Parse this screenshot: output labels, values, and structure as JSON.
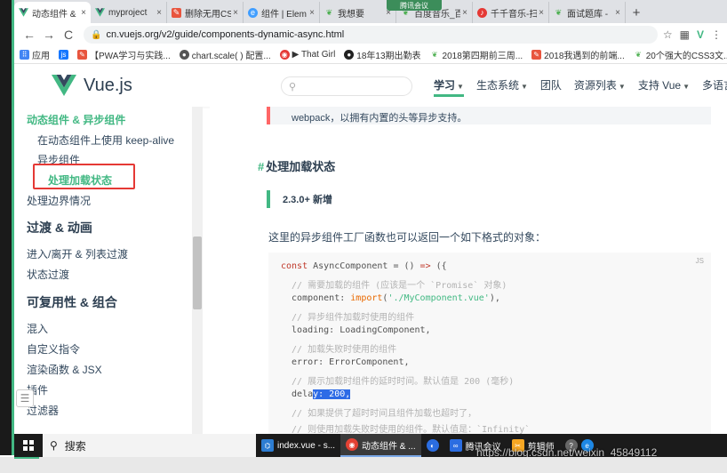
{
  "browser": {
    "tabs": [
      {
        "label": "动态组件 &",
        "icon": "vue-icon",
        "active": true
      },
      {
        "label": "myproject",
        "icon": "vue-icon"
      },
      {
        "label": "删除无用CS",
        "icon": "doc-icon"
      },
      {
        "label": "组件 | Elem",
        "icon": "element-icon"
      },
      {
        "label": "我想要",
        "icon": "leaf-icon"
      },
      {
        "label": "百度音乐_百",
        "icon": "leaf-icon"
      },
      {
        "label": "千千音乐-扫",
        "icon": "music-icon"
      },
      {
        "label": "面试题库 - ",
        "icon": "leaf-icon"
      }
    ],
    "new_tab": "+",
    "tab_close": "×",
    "meeting_label": "腾讯会议",
    "url": "cn.vuejs.org/v2/guide/components-dynamic-async.html",
    "nav": {
      "back": "←",
      "forward": "→",
      "reload": "C"
    },
    "bookmarks": [
      {
        "label": "应用",
        "color": "#4285f4"
      },
      {
        "label": "",
        "color": "#1677ff",
        "badge": "js"
      },
      {
        "label": "【PWA学习与实践...",
        "color": "#e8553e"
      },
      {
        "label": "chart.scale( ) 配置...",
        "color": "#555"
      },
      {
        "label": "▶ That Girl",
        "color": "#e53935"
      },
      {
        "label": "18年13期出勤表",
        "color": "#222"
      },
      {
        "label": "2018第四期前三周...",
        "color": "#4caf50"
      },
      {
        "label": "2018我遇到的前端...",
        "color": "#e8553e"
      },
      {
        "label": "20个强大的CSS3文...",
        "color": "#4caf50"
      }
    ]
  },
  "site": {
    "logo_text": "Vue.js",
    "search_placeholder": "",
    "nav": [
      {
        "label": "学习",
        "dropdown": true,
        "current": true
      },
      {
        "label": "生态系统",
        "dropdown": true
      },
      {
        "label": "团队",
        "dropdown": false
      },
      {
        "label": "资源列表",
        "dropdown": true
      },
      {
        "label": "支持 Vue",
        "dropdown": true
      },
      {
        "label": "多语言",
        "dropdown": false
      }
    ]
  },
  "sidebar": {
    "items": [
      {
        "label": "动态组件 & 异步组件",
        "kind": "sub"
      },
      {
        "label": "在动态组件上使用 keep-alive",
        "kind": "nested"
      },
      {
        "label": "异步组件",
        "kind": "nested"
      },
      {
        "label": "处理加载状态",
        "kind": "current"
      },
      {
        "label": "处理边界情况",
        "kind": "item"
      },
      {
        "label": "过渡 & 动画",
        "kind": "section"
      },
      {
        "label": "进入/离开 & 列表过渡",
        "kind": "item"
      },
      {
        "label": "状态过渡",
        "kind": "item"
      },
      {
        "label": "可复用性 & 组合",
        "kind": "section"
      },
      {
        "label": "混入",
        "kind": "item"
      },
      {
        "label": "自定义指令",
        "kind": "item"
      },
      {
        "label": "渲染函数 & JSX",
        "kind": "item"
      },
      {
        "label": "插件",
        "kind": "item"
      },
      {
        "label": "过滤器",
        "kind": "item"
      }
    ]
  },
  "content": {
    "tip_text": "webpack，以拥有内置的头等异步支持。",
    "heading_hash": "#",
    "heading": "处理加载状态",
    "new_badge": "2.3.0+ 新增",
    "paragraph": "这里的异步组件工厂函数也可以返回一个如下格式的对象：",
    "code_lang": "JS",
    "code_lines": [
      "const AsyncComponent = () => ({",
      "  // 需要加载的组件 (应该是一个 `Promise` 对象)",
      "  component: import('./MyComponent.vue'),",
      "  // 异步组件加载时使用的组件",
      "  loading: LoadingComponent,",
      "  // 加载失败时使用的组件",
      "  error: ErrorComponent,",
      "  // 展示加载时组件的延时时间。默认值是 200 (毫秒)",
      "  delay: 200,",
      "  // 如果提供了超时时间且组件加载也超时了，",
      "  // 则使用加载失败时使用的组件。默认值是：`Infinity`"
    ]
  },
  "taskbar": {
    "search_label": "搜索",
    "apps": [
      {
        "label": "index.vue - s...",
        "icon": "vscode-icon",
        "color": "#2d7dd2"
      },
      {
        "label": "动态组件 & ...",
        "icon": "chrome-icon",
        "color": "#e34133",
        "active": true
      },
      {
        "label": "",
        "icon": "meeting-icon",
        "color": "#2b6de1"
      },
      {
        "label": "腾讯会议",
        "icon": "tencent-meeting-icon",
        "color": "#2b6de1"
      },
      {
        "label": "剪辑师",
        "icon": "editor-icon",
        "color": "#f5a623"
      }
    ],
    "watermark": "https://blog.csdn.net/weixin_45849112"
  }
}
